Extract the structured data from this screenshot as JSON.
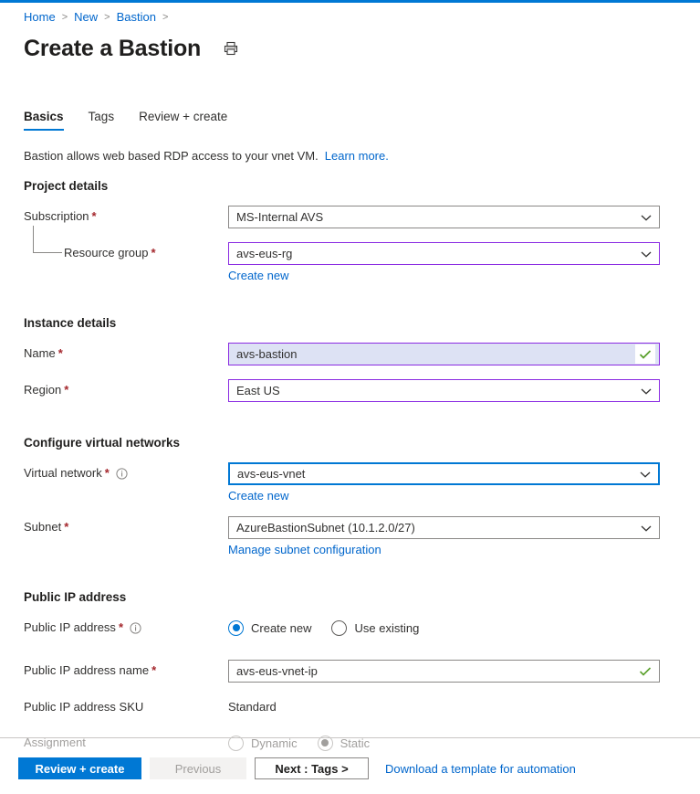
{
  "theme": {
    "accent": "#0078d4",
    "link": "#0066cc",
    "required_asterisk": "#a4262c",
    "purple_border": "#8a2be2",
    "valid_check": "#5aa02c",
    "selection_bg": "#dde2f4"
  },
  "breadcrumb": {
    "items": [
      "Home",
      "New",
      "Bastion"
    ],
    "separator": ">"
  },
  "header": {
    "title": "Create a Bastion",
    "print_icon": "print-icon"
  },
  "tabs": [
    {
      "label": "Basics",
      "active": true
    },
    {
      "label": "Tags",
      "active": false
    },
    {
      "label": "Review + create",
      "active": false
    }
  ],
  "description": {
    "text": "Bastion allows web based RDP access to your vnet VM.",
    "link": "Learn more."
  },
  "sections": {
    "project_details": {
      "heading": "Project details",
      "subscription": {
        "label": "Subscription",
        "required": true,
        "value": "MS-Internal AVS",
        "border": "gray"
      },
      "resource_group": {
        "label": "Resource group",
        "required": true,
        "value": "avs-eus-rg",
        "border": "purple",
        "sublink": "Create new"
      }
    },
    "instance_details": {
      "heading": "Instance details",
      "name": {
        "label": "Name",
        "required": true,
        "value": "avs-bastion",
        "border": "purple",
        "selected": true,
        "valid": true
      },
      "region": {
        "label": "Region",
        "required": true,
        "value": "East US",
        "border": "purple"
      }
    },
    "configure_virtual_networks": {
      "heading": "Configure virtual networks",
      "virtual_network": {
        "label": "Virtual network",
        "required": true,
        "info": true,
        "value": "avs-eus-vnet",
        "border": "blue",
        "sublink": "Create new"
      },
      "subnet": {
        "label": "Subnet",
        "required": true,
        "value": "AzureBastionSubnet (10.1.2.0/27)",
        "border": "gray",
        "sublink": "Manage subnet configuration"
      }
    },
    "public_ip_address": {
      "heading": "Public IP address",
      "public_ip": {
        "label": "Public IP address",
        "required": true,
        "info": true,
        "options": [
          {
            "label": "Create new",
            "selected": true
          },
          {
            "label": "Use existing",
            "selected": false
          }
        ]
      },
      "public_ip_name": {
        "label": "Public IP address name",
        "required": true,
        "value": "avs-eus-vnet-ip",
        "border": "gray",
        "valid": true
      },
      "public_ip_sku": {
        "label": "Public IP address SKU",
        "required": false,
        "value": "Standard"
      },
      "assignment": {
        "label": "Assignment",
        "disabled": true,
        "options": [
          {
            "label": "Dynamic",
            "selected": false
          },
          {
            "label": "Static",
            "selected": true
          }
        ]
      }
    }
  },
  "footer": {
    "review_create": "Review + create",
    "previous": "Previous",
    "next": "Next : Tags >",
    "download_template": "Download a template for automation"
  }
}
